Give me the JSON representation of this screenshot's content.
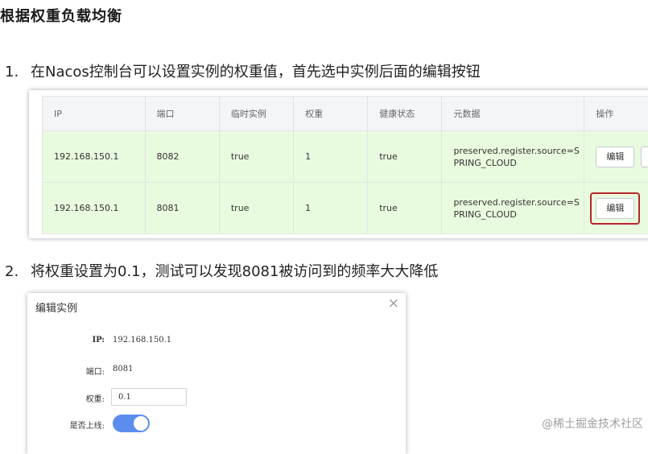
{
  "heading": "根据权重负载均衡",
  "steps": [
    {
      "num": "1.",
      "text": "在Nacos控制台可以设置实例的权重值，首先选中实例后面的编辑按钮"
    },
    {
      "num": "2.",
      "text": "将权重设置为0.1，测试可以发现8081被访问到的频率大大降低"
    }
  ],
  "table": {
    "headers": [
      "IP",
      "端口",
      "临时实例",
      "权重",
      "健康状态",
      "元数据",
      "操作"
    ],
    "rows": [
      {
        "ip": "192.168.150.1",
        "port": "8082",
        "ephemeral": "true",
        "weight": "1",
        "healthy": "true",
        "meta_line1": "preserved.register.source=S",
        "meta_line2": "PRING_CLOUD",
        "action": "编辑"
      },
      {
        "ip": "192.168.150.1",
        "port": "8081",
        "ephemeral": "true",
        "weight": "1",
        "healthy": "true",
        "meta_line1": "preserved.register.source=S",
        "meta_line2": "PRING_CLOUD",
        "action": "编辑"
      }
    ]
  },
  "dialog": {
    "title": "编辑实例",
    "close": "×",
    "ip_label": "IP:",
    "ip_value": "192.168.150.1",
    "port_label": "端口:",
    "port_value": "8081",
    "weight_label": "权重:",
    "weight_value": "0.1",
    "online_label": "是否上线:",
    "online": true,
    "toggle_color": "#5b8def"
  },
  "watermark": "@稀土掘金技术社区",
  "colors": {
    "row_healthy": "#e9fbde",
    "highlight": "#b5262d"
  }
}
